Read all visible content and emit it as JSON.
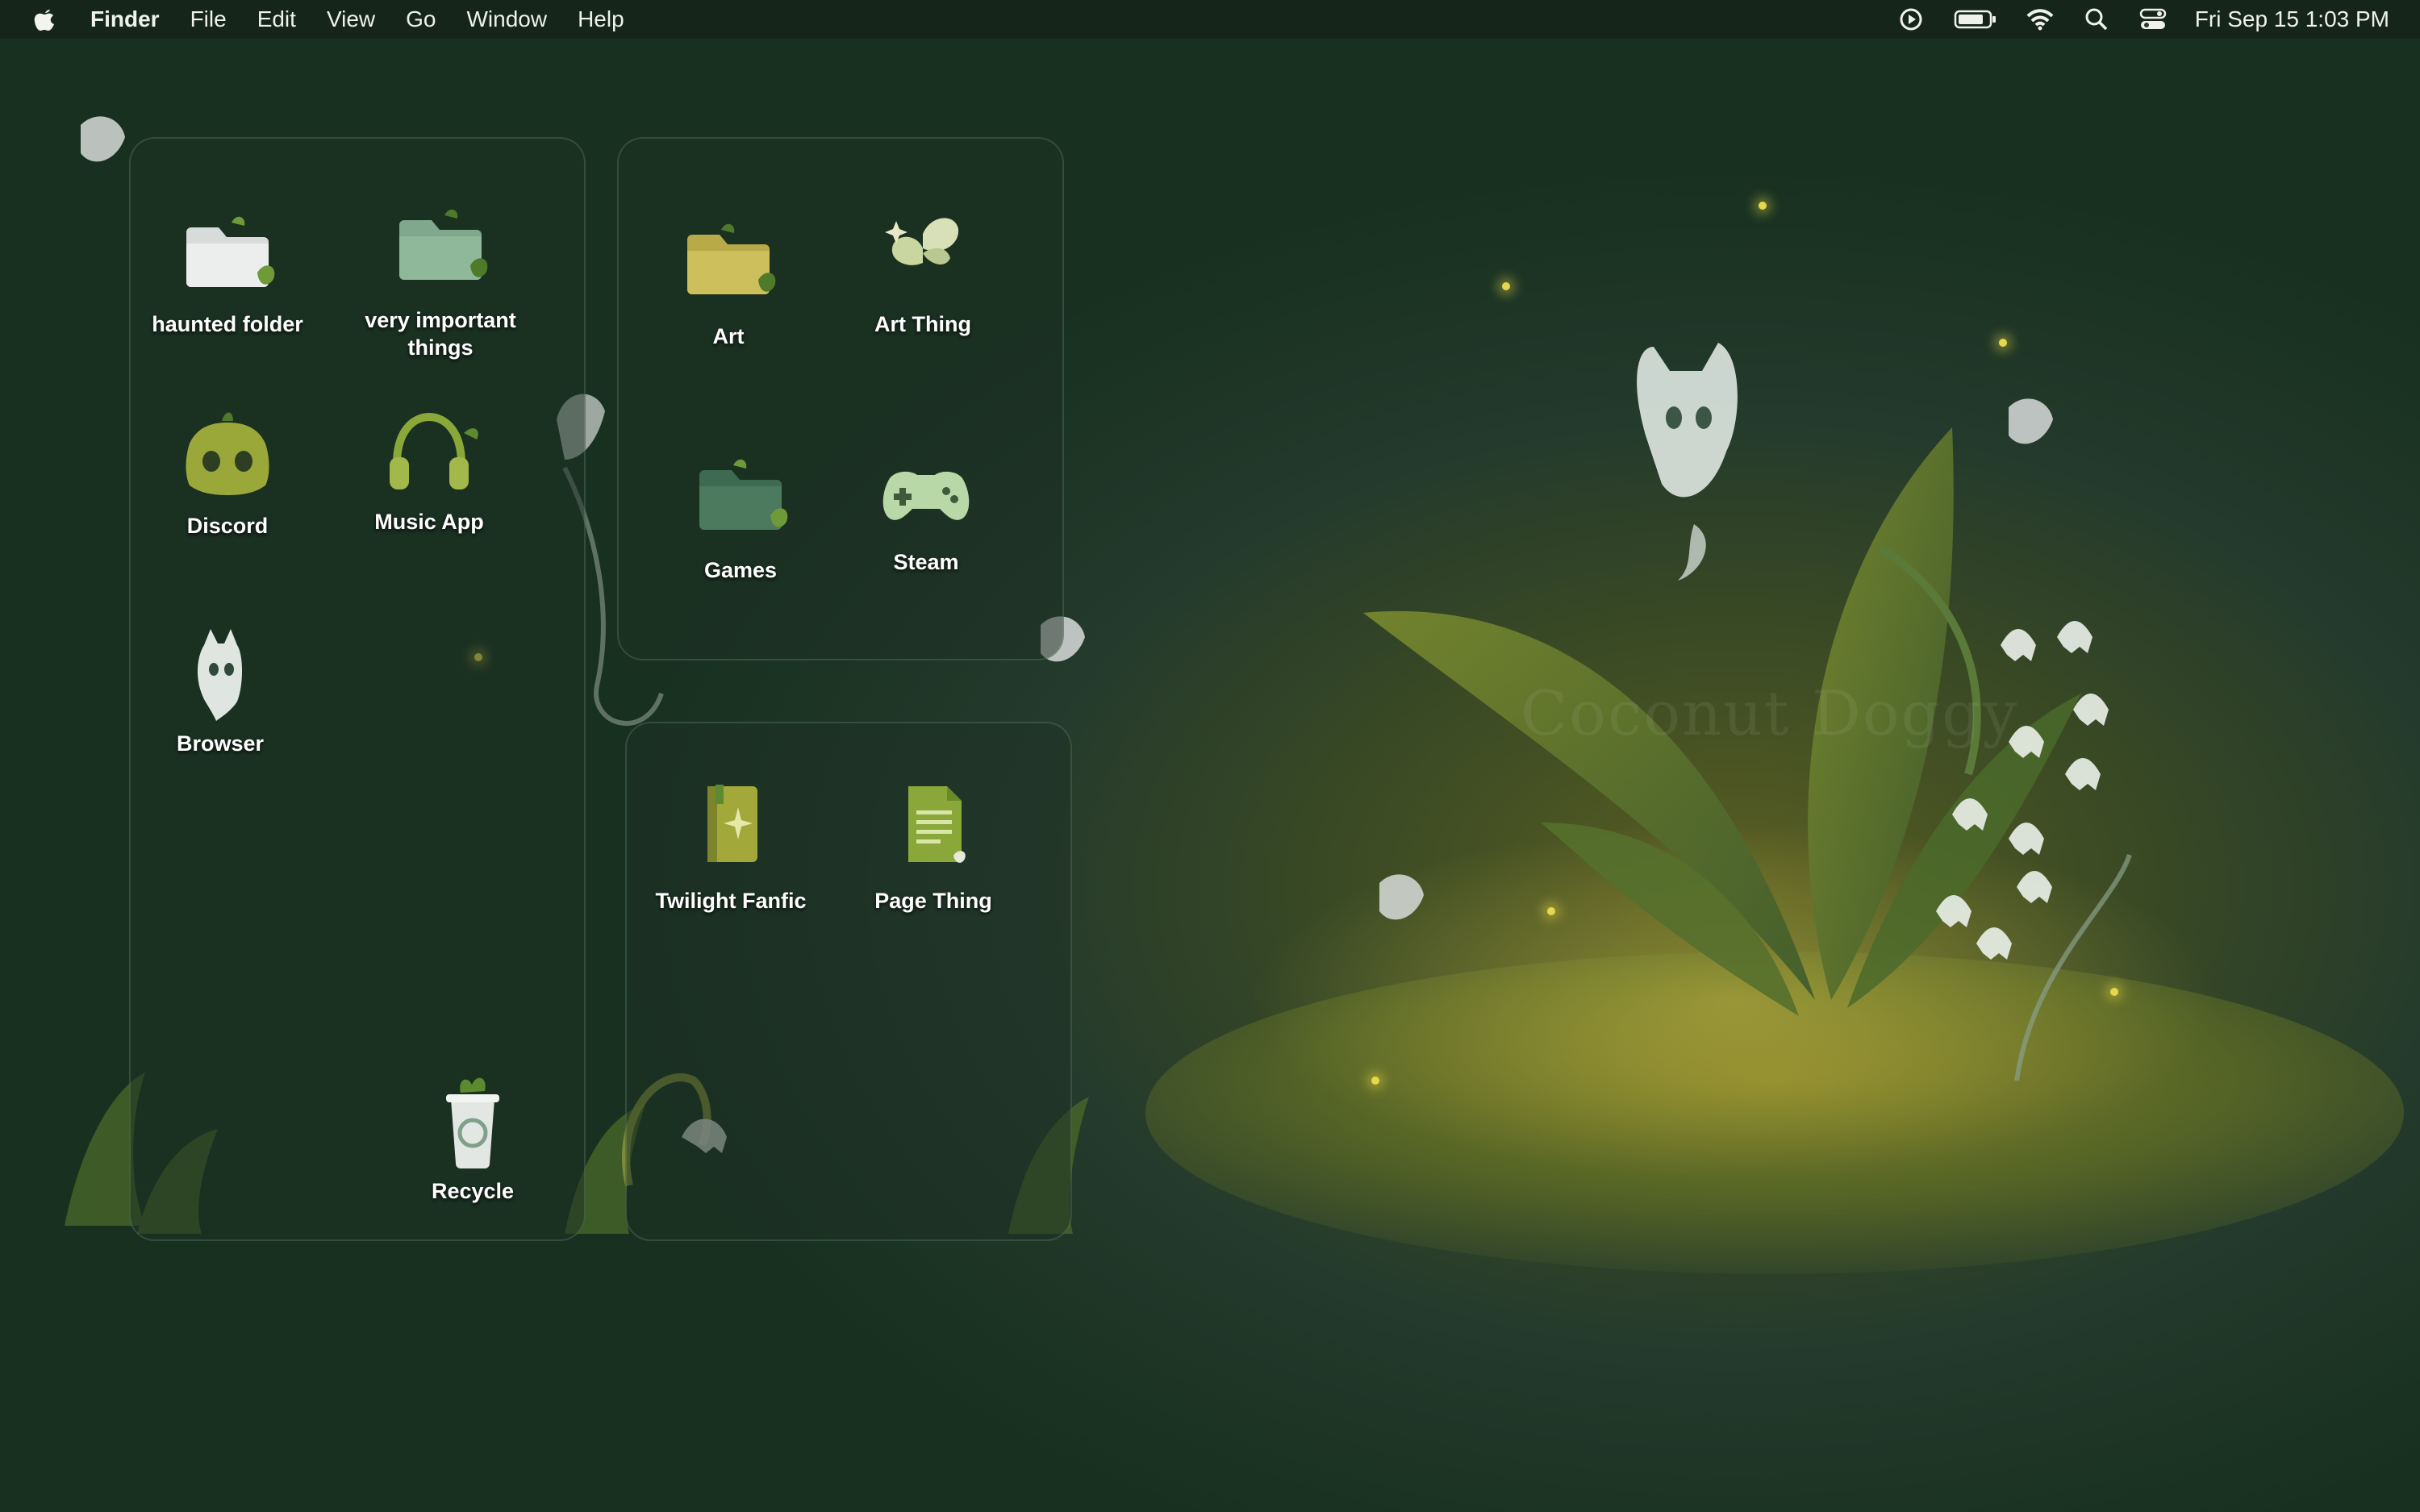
{
  "menubar": {
    "app_name": "Finder",
    "items": [
      "File",
      "Edit",
      "View",
      "Go",
      "Window",
      "Help"
    ],
    "clock": "Fri Sep 15  1:03 PM",
    "status_icons": [
      "play-circle-icon",
      "battery-icon",
      "wifi-icon",
      "search-icon",
      "control-center-icon"
    ]
  },
  "desktop": {
    "icons": {
      "haunted_folder": "haunted folder",
      "very_important": "very important things",
      "discord": "Discord",
      "music_app": "Music App",
      "browser": "Browser",
      "recycle": "Recycle",
      "art": "Art",
      "art_thing": "Art Thing",
      "games": "Games",
      "steam": "Steam",
      "twilight_fanfic": "Twilight Fanfic",
      "page_thing": "Page Thing"
    }
  },
  "wallpaper": {
    "watermark": "Coconut Doggy"
  },
  "colors": {
    "leaf": "#4f6a2a",
    "folder_green": "#8fb89a",
    "folder_yellow": "#cdbf5c",
    "ghost": "#e8eee6",
    "firefly": "#e6d84a"
  }
}
